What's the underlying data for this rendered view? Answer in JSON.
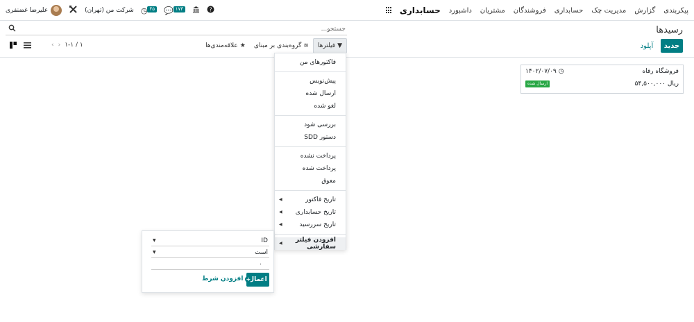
{
  "navbar": {
    "brand": "حسابداری",
    "menu": [
      "داشبورد",
      "مشتریان",
      "فروشندگان",
      "حسابداری",
      "مدیریت چک",
      "گزارش",
      "پیکربندی"
    ],
    "company": "شرکت من (تهران)",
    "user": "علیرضا غضنفری",
    "activity_count": "۴۵",
    "message_count": "۱۷۳"
  },
  "page": {
    "title": "رسیدها",
    "new_label": "جدید",
    "upload_label": "آپلود",
    "search_placeholder": "جستجو..."
  },
  "toggles": {
    "filters": "فیلترها",
    "group_by": "گروه‌بندی بر مبنای",
    "favorites": "علاقه‌مندی‌ها"
  },
  "pager": {
    "value": "۱-۱ / ۱"
  },
  "card": {
    "partner": "فروشگاه رفاه",
    "date": "۱۴۰۲/۰۷/۰۹",
    "amount": "ریال ۵۴,۵۰۰,۰۰۰",
    "status": "ارسال شده"
  },
  "filter_menu": {
    "group1": [
      "فاکتورهای من"
    ],
    "group2": [
      "پیش‌نویس",
      "ارسال شده",
      "لغو شده"
    ],
    "group3": [
      "بررسی شود",
      "دستور SDD"
    ],
    "group4": [
      "پرداخت نشده",
      "پرداخت شده",
      "معوق"
    ],
    "group5": [
      "تاریخ فاکتور",
      "تاریخ حسابداری",
      "تاریخ سررسید"
    ],
    "custom": "افزودن فیلتر سفارشی"
  },
  "custom_filter": {
    "field": "ID",
    "operator": "است",
    "value": "۰",
    "apply": "اعمال",
    "add_condition": "افزودن شرط"
  },
  "colors": {
    "primary": "#017e84",
    "success": "#28a745"
  }
}
